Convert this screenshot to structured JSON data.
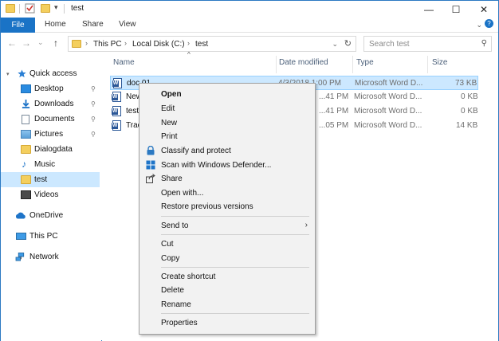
{
  "window": {
    "title": "test",
    "controls": {
      "minimize": "—",
      "maximize": "☐",
      "close": "✕"
    },
    "qat_dropdown": "▾"
  },
  "ribbon": {
    "tabs": [
      "File",
      "Home",
      "Share",
      "View"
    ],
    "collapse": "⌄",
    "help": "?"
  },
  "nav": {
    "back": "←",
    "forward": "→",
    "recent": "⌄",
    "up": "↑",
    "breadcrumb": [
      "This PC",
      "Local Disk (C:)",
      "test"
    ],
    "breadcrumb_sep": "›",
    "address_dropdown": "⌄",
    "refresh": "↻"
  },
  "search": {
    "placeholder": "Search test",
    "icon": "search-icon",
    "glyph": "⚲"
  },
  "sidebar": {
    "items": [
      {
        "label": "Quick access",
        "icon": "star-icon",
        "pinned": false,
        "selected": false
      },
      {
        "label": "Desktop",
        "icon": "desktop-icon",
        "pinned": true,
        "selected": false
      },
      {
        "label": "Downloads",
        "icon": "download-icon",
        "pinned": true,
        "selected": false
      },
      {
        "label": "Documents",
        "icon": "documents-icon",
        "pinned": true,
        "selected": false
      },
      {
        "label": "Pictures",
        "icon": "pictures-icon",
        "pinned": true,
        "selected": false
      },
      {
        "label": "Dialogdata",
        "icon": "folder-icon",
        "pinned": false,
        "selected": false
      },
      {
        "label": "Music",
        "icon": "music-icon",
        "pinned": false,
        "selected": false
      },
      {
        "label": "test",
        "icon": "folder-icon",
        "pinned": false,
        "selected": true
      },
      {
        "label": "Videos",
        "icon": "videos-icon",
        "pinned": false,
        "selected": false
      },
      {
        "label": "OneDrive",
        "icon": "cloud-icon",
        "pinned": false,
        "selected": false
      },
      {
        "label": "This PC",
        "icon": "computer-icon",
        "pinned": false,
        "selected": false
      },
      {
        "label": "Network",
        "icon": "network-icon",
        "pinned": false,
        "selected": false
      }
    ],
    "pin_glyph": "📌"
  },
  "columns": [
    "Name",
    "Date modified",
    "Type",
    "Size"
  ],
  "files": [
    {
      "name": "doc 01",
      "date": "4/3/2018 1:00 PM",
      "type": "Microsoft Word D...",
      "size": "73 KB",
      "selected": true
    },
    {
      "name": "New",
      "date": "...41 PM",
      "type": "Microsoft Word D...",
      "size": "0 KB",
      "selected": false
    },
    {
      "name": "test",
      "date": "...41 PM",
      "type": "Microsoft Word D...",
      "size": "0 KB",
      "selected": false
    },
    {
      "name": "Trac",
      "date": "...05 PM",
      "type": "Microsoft Word D...",
      "size": "14 KB",
      "selected": false
    }
  ],
  "context_menu": {
    "items": [
      {
        "label": "Open",
        "bold": true
      },
      {
        "label": "Edit"
      },
      {
        "label": "New"
      },
      {
        "label": "Print"
      },
      {
        "label": "Classify and protect",
        "icon": "lock-icon"
      },
      {
        "label": "Scan with Windows Defender...",
        "icon": "defender-icon"
      },
      {
        "label": "Share",
        "icon": "share-icon"
      },
      {
        "label": "Open with..."
      },
      {
        "label": "Restore previous versions"
      },
      {
        "separator": true
      },
      {
        "label": "Send to",
        "submenu": true
      },
      {
        "separator": true
      },
      {
        "label": "Cut"
      },
      {
        "label": "Copy"
      },
      {
        "separator": true
      },
      {
        "label": "Create shortcut"
      },
      {
        "label": "Delete"
      },
      {
        "label": "Rename"
      },
      {
        "separator": true
      },
      {
        "label": "Properties"
      }
    ],
    "submenu_arrow": "›"
  },
  "colors": {
    "accent": "#1a73c6",
    "selection": "#cce8ff",
    "selection_border": "#99d1ff",
    "menu_bg": "#f2f2f2"
  }
}
